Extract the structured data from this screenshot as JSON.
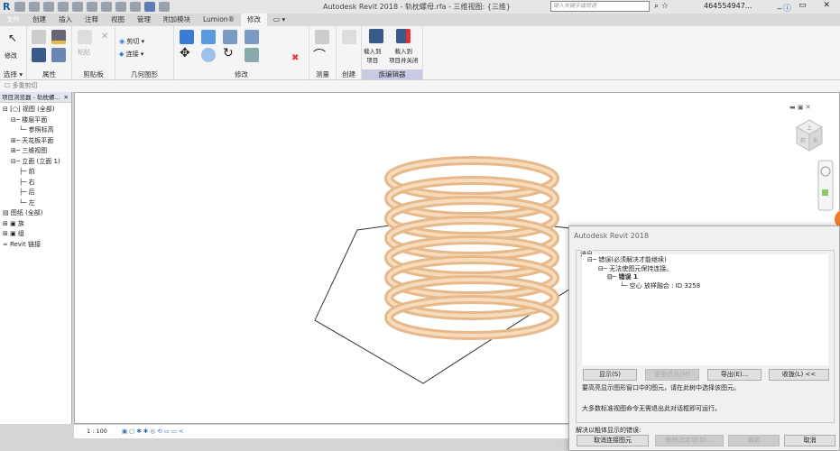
{
  "titlebar": {
    "title": "Autodesk Revit 2018 -    轨枕螺母.rfa - 三维视图: {三维}",
    "search_placeholder": "键入关键字或短语",
    "user": "464554947...",
    "window_controls": "_ ▭ ✕"
  },
  "tabs": [
    "文件",
    "创建",
    "插入",
    "注释",
    "视图",
    "管理",
    "附加模块",
    "Lumion®",
    "修改",
    "▭ ▾"
  ],
  "ribbon": {
    "panels": [
      "选择 ▾",
      "属性",
      "剪贴板",
      "几何图形",
      "修改",
      "测量",
      "创建",
      "族编辑器"
    ],
    "modify": "修改",
    "paste": "粘贴",
    "cut": "剪切 ▾",
    "join": "连接 ▾",
    "load_project": "载入到\n项目",
    "load_close": "载入到\n项目并关闭"
  },
  "options_bar": {
    "multi_cut": "多重剪切"
  },
  "browser": {
    "title": "项目浏览器 - 轨枕螺...",
    "close": "✕",
    "items": [
      {
        "t": "⊟ ⁅○⁆ 视图 (全部)",
        "d": 0
      },
      {
        "t": "⊟─ 楼层平面",
        "d": 1
      },
      {
        "t": "└─ 参照标高",
        "d": 2
      },
      {
        "t": "⊞─ 天花板平面",
        "d": 1
      },
      {
        "t": "⊞─ 三维视图",
        "d": 1
      },
      {
        "t": "⊟─ 立面 (立面 1)",
        "d": 1
      },
      {
        "t": "├─ 前",
        "d": 2
      },
      {
        "t": "├─ 右",
        "d": 2
      },
      {
        "t": "├─ 后",
        "d": 2
      },
      {
        "t": "└─ 左",
        "d": 2
      },
      {
        "t": "▤ 图纸 (全部)",
        "d": 0
      },
      {
        "t": "⊞ ▣ 族",
        "d": 0
      },
      {
        "t": "⊞ ▣ 组",
        "d": 0
      },
      {
        "t": "∞ Revit 链接",
        "d": 0
      }
    ]
  },
  "viewcube": {
    "top": "上",
    "front": "前",
    "right": "右"
  },
  "status": {
    "scale": "1 : 100",
    "icons": "▣ ▢ ✱ ✱ ◎ ⟲ ▭ ▭ <"
  },
  "dialog": {
    "title": "Autodesk Revit 2018",
    "group": "消息",
    "tree": [
      "⊟─ 错误(必须解决才能继续)",
      "⊟─ 无法使图元保持连接。",
      "⊟─ 错误 1",
      "└─ 空心 放样融合 : ID 3258"
    ],
    "buttons": {
      "show": "显示(S)",
      "more": "更多信息(M)",
      "export": "导出(E)...",
      "collapse": "收拢(L) <<"
    },
    "hint1": "要高亮显示图形窗口中的图元，请在此树中选择该图元。",
    "hint2": "大多数标准视图命令无需退出此对话框即可运行。",
    "resolve_label": "解决以粗体显示的错误:",
    "actions": {
      "unjoin": "取消连接图元",
      "delete": "删除选定项(D)...",
      "ok": "确定",
      "cancel": "取消"
    }
  }
}
